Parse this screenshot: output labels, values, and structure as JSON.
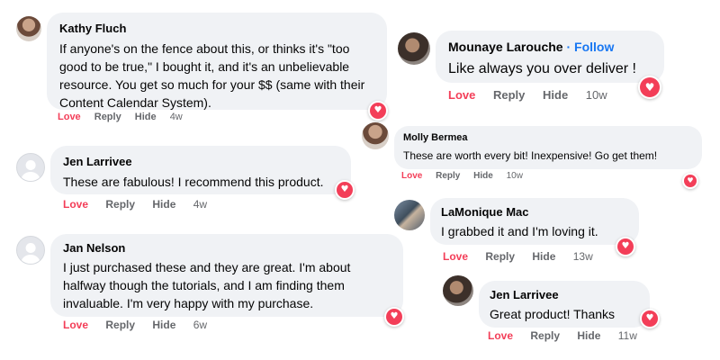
{
  "actions": {
    "love": "Love",
    "reply": "Reply",
    "hide": "Hide"
  },
  "icons": {
    "reaction": "heart-icon",
    "avatar_placeholder": "person-silhouette-icon"
  },
  "colors": {
    "love": "#f33e58",
    "follow": "#1877f2",
    "bubble": "#f0f2f5",
    "meta": "#65676b"
  },
  "comments": [
    {
      "author": "Kathy Fluch",
      "text": "If anyone's on the fence about this, or thinks it's \"too good to be true,\" I bought it, and it's an unbelievable resource. You get so much for your $$ (same with their Content Calendar System).",
      "time": "4w"
    },
    {
      "author": "Jen Larrivee",
      "text": "These are fabulous! I recommend this product.",
      "time": "4w"
    },
    {
      "author": "Jan Nelson",
      "text": "I just purchased these and they are great. I'm about halfway though the tutorials, and I am finding them invaluable. I'm very happy with my purchase.",
      "time": "6w"
    },
    {
      "author": "Mounaye Larouche",
      "follow": "Follow",
      "text": "Like always you over deliver !",
      "time": "10w"
    },
    {
      "author": "Molly Bermea",
      "text": "These are worth every bit! Inexpensive! Go get them!",
      "time": "10w"
    },
    {
      "author": "LaMonique Mac",
      "text": "I grabbed it and I'm loving it.",
      "time": "13w"
    },
    {
      "author": "Jen Larrivee",
      "text": "Great product! Thanks",
      "time": "11w"
    }
  ]
}
